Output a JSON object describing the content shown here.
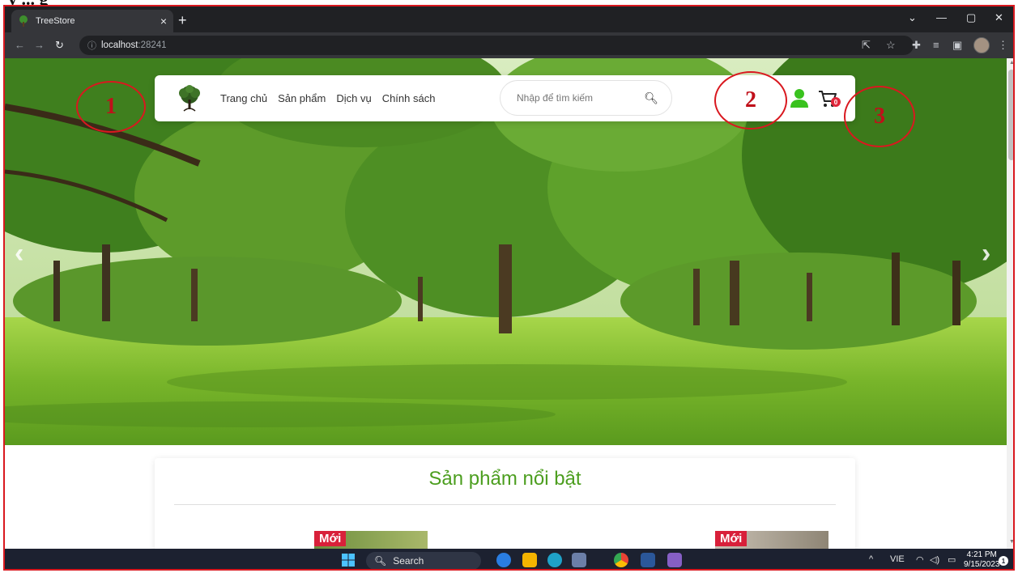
{
  "browser": {
    "tab_title": "TreeStore",
    "tab_close": "×",
    "new_tab": "+",
    "url_host": "localhost",
    "url_port": ":28241",
    "icons": [
      "back-icon",
      "forward-icon",
      "reload-icon",
      "info-icon",
      "share-icon",
      "star-icon",
      "extensions-icon",
      "reading-list-icon",
      "side-panel-icon",
      "profile-avatar",
      "menu-icon"
    ]
  },
  "header": {
    "nav": [
      "Trang chủ",
      "Sản phẩm",
      "Dịch vụ",
      "Chính sách"
    ],
    "search_placeholder": "Nhập để tìm kiếm",
    "cart_count": "0",
    "accent_user": "#39c21e",
    "accent_cart_badge": "#e0263a"
  },
  "annotations": [
    "1",
    "2",
    "3"
  ],
  "featured": {
    "title": "Sản phẩm nổi bật",
    "badge": "Mới",
    "title_color": "#4c9e1f"
  },
  "taskbar": {
    "search_label": "Search",
    "language": "VIE",
    "time": "4:21 PM",
    "date": "9/15/2023",
    "notification_count": "1"
  }
}
